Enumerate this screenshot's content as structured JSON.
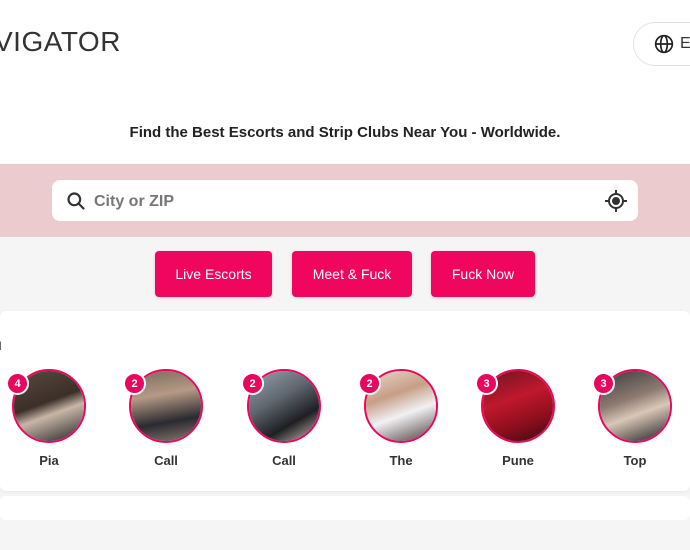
{
  "header": {
    "logo_text": "VIGATOR",
    "language_label": "E"
  },
  "tagline": "Find the Best Escorts and Strip Clubs Near You - Worldwide.",
  "search": {
    "placeholder": "City or ZIP",
    "value": ""
  },
  "buttons": [
    {
      "label": "Live Escorts"
    },
    {
      "label": "Meet & Fuck"
    },
    {
      "label": "Fuck Now"
    }
  ],
  "stories_section": {
    "title": "u",
    "items": [
      {
        "name": "Pia",
        "count": "4"
      },
      {
        "name": "Call",
        "count": "2"
      },
      {
        "name": "Call",
        "count": "2"
      },
      {
        "name": "The",
        "count": "2"
      },
      {
        "name": "Pune",
        "count": "3"
      },
      {
        "name": "Top",
        "count": "3"
      }
    ]
  },
  "colors": {
    "accent": "#f0055f",
    "search_band": "#eccbcf",
    "badge": "#e8075d"
  }
}
